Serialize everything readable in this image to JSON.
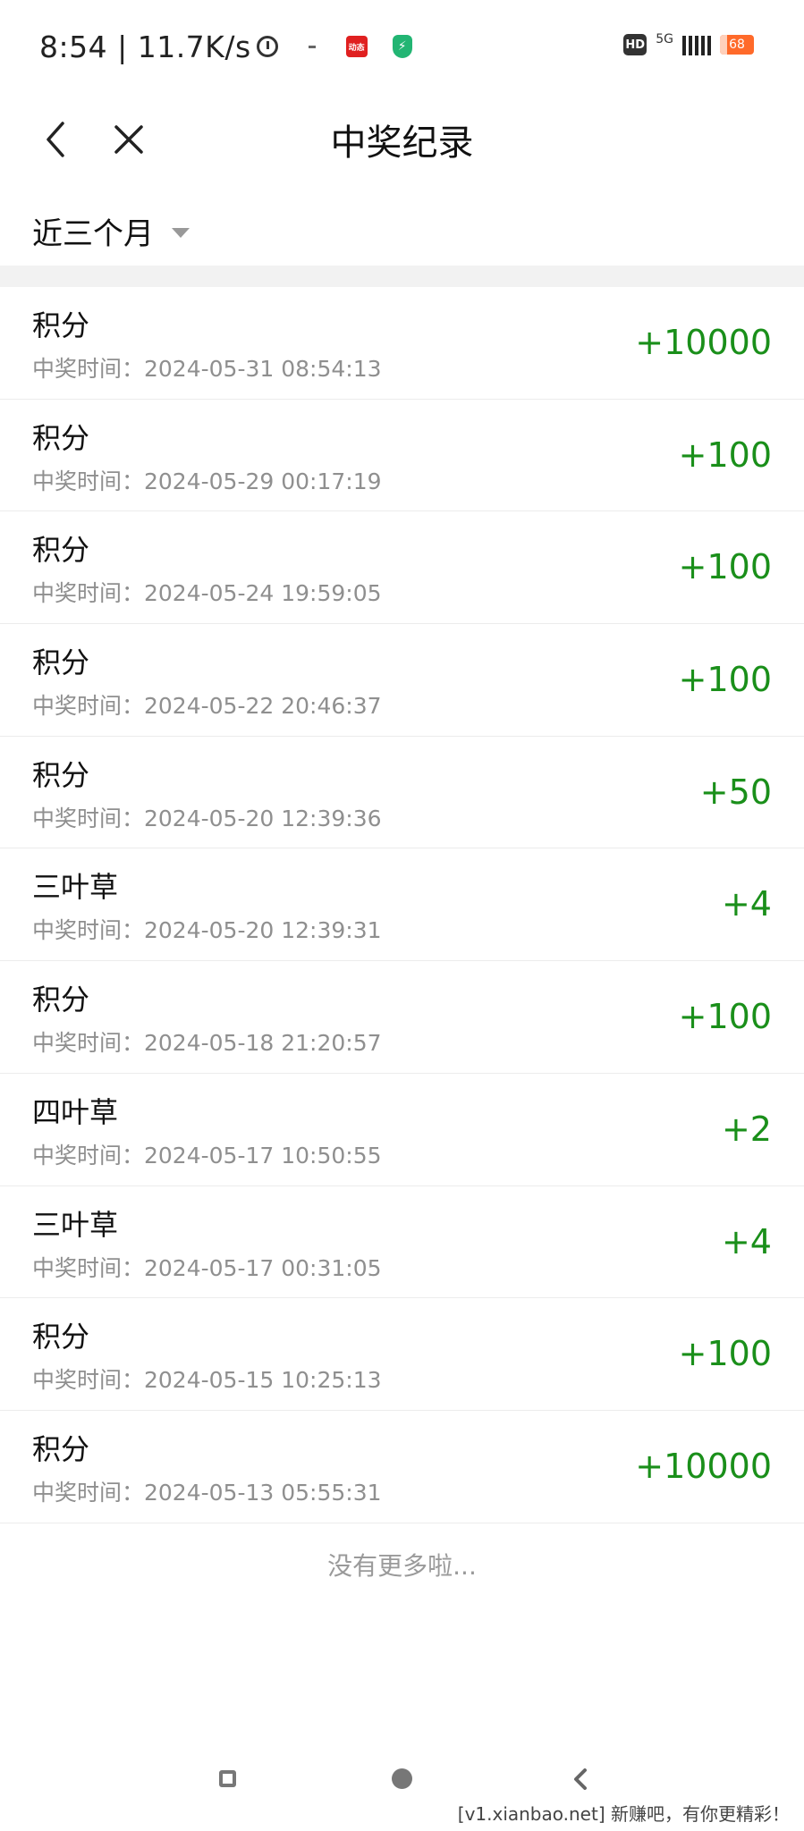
{
  "status_bar": {
    "time": "8:54 | 11.7K/s",
    "red_app_label": "动态",
    "hd_label": "HD",
    "network_label": "5G",
    "battery": "68"
  },
  "nav": {
    "title": "中奖纪录"
  },
  "filter": {
    "label": "近三个月"
  },
  "records": [
    {
      "name": "积分",
      "time": "中奖时间：2024-05-31 08:54:13",
      "amount": "+10000"
    },
    {
      "name": "积分",
      "time": "中奖时间：2024-05-29 00:17:19",
      "amount": "+100"
    },
    {
      "name": "积分",
      "time": "中奖时间：2024-05-24 19:59:05",
      "amount": "+100"
    },
    {
      "name": "积分",
      "time": "中奖时间：2024-05-22 20:46:37",
      "amount": "+100"
    },
    {
      "name": "积分",
      "time": "中奖时间：2024-05-20 12:39:36",
      "amount": "+50"
    },
    {
      "name": "三叶草",
      "time": "中奖时间：2024-05-20 12:39:31",
      "amount": "+4"
    },
    {
      "name": "积分",
      "time": "中奖时间：2024-05-18 21:20:57",
      "amount": "+100"
    },
    {
      "name": "四叶草",
      "time": "中奖时间：2024-05-17 10:50:55",
      "amount": "+2"
    },
    {
      "name": "三叶草",
      "time": "中奖时间：2024-05-17 00:31:05",
      "amount": "+4"
    },
    {
      "name": "积分",
      "time": "中奖时间：2024-05-15 10:25:13",
      "amount": "+100"
    },
    {
      "name": "积分",
      "time": "中奖时间：2024-05-13 05:55:31",
      "amount": "+10000"
    }
  ],
  "footer": {
    "no_more": "没有更多啦..."
  },
  "watermark": "[v1.xianbao.net] 新赚吧，有你更精彩！",
  "colors": {
    "amount": "#1a8f1a",
    "divider": "#f2f2f2",
    "secondary_text": "#8f8f8f"
  }
}
